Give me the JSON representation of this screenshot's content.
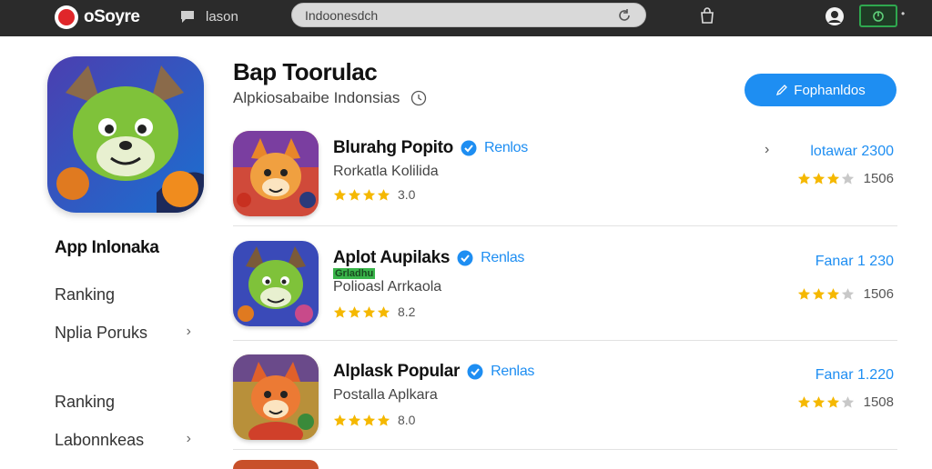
{
  "topbar": {
    "logo_text": "oSoyre",
    "nav_link": "lason",
    "search_value": "Indoonesdch",
    "search_placeholder": "Indoonesdch"
  },
  "sidebar": {
    "title": "App Inlonaka",
    "items": [
      {
        "label": "Ranking",
        "chevron": false
      },
      {
        "label": "Nplia Poruks",
        "chevron": true
      },
      {
        "label": "Ranking",
        "chevron": false
      },
      {
        "label": "Labonnkeas",
        "chevron": true
      }
    ]
  },
  "header": {
    "title": "Bap Toorulac",
    "subtitle": "Alpkiosabaibe Indonsias",
    "action_label": "Fophanldos"
  },
  "apps": [
    {
      "name": "Blurahg Popito",
      "tag": "Renlos",
      "badge": "",
      "category": "Rorkatla Kolilida",
      "rating": "3.0",
      "stars": 4,
      "meta": "lotawar 2300",
      "score": "1506",
      "score_stars": 3,
      "chevron": "›"
    },
    {
      "name": "Aplot Aupilaks",
      "tag": "Renlas",
      "badge": "Grladhu",
      "category": "Polioasl Arrkaola",
      "rating": "8.2",
      "stars": 4,
      "meta": "Fanar 1 230",
      "score": "1506",
      "score_stars": 3,
      "chevron": ""
    },
    {
      "name": "Alplask Popular",
      "tag": "Renlas",
      "badge": "",
      "category": "Postalla Aplkara",
      "rating": "8.0",
      "stars": 4,
      "meta": "Fanar 1.220",
      "score": "1508",
      "score_stars": 3,
      "chevron": ""
    }
  ],
  "colors": {
    "accent": "#1e8ef2",
    "topbar": "#2b2b2b",
    "star": "#f5b800",
    "badge": "#39b54a"
  }
}
